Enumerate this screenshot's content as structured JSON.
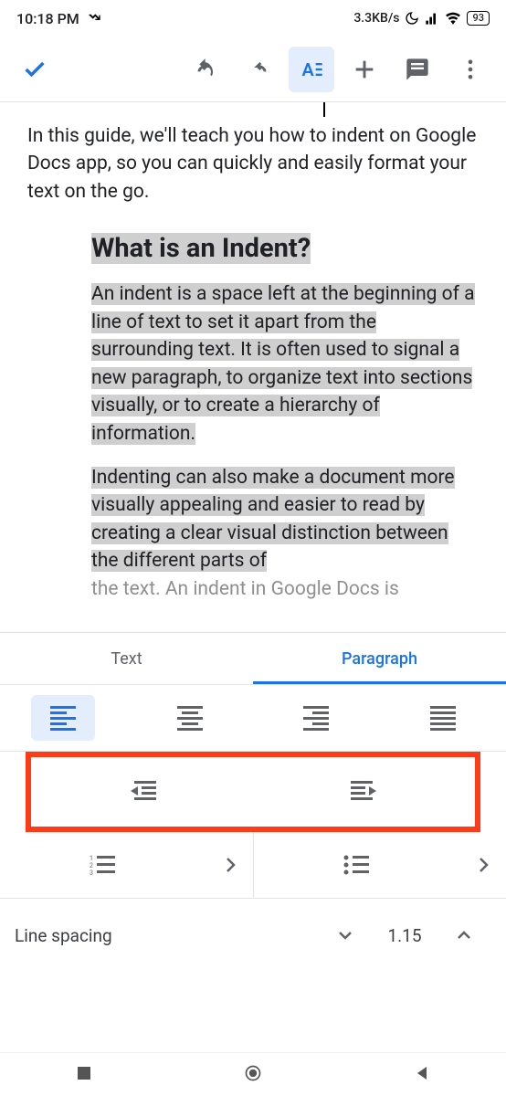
{
  "status": {
    "time": "10:18 PM",
    "net_speed": "3.3KB/s",
    "battery": "93"
  },
  "toolbar": {
    "format_letter": "A"
  },
  "document": {
    "intro": "In this guide, we'll teach you how to indent on Google Docs app, so you can quickly and easily format your text on the go.",
    "heading": "What is an Indent?",
    "p1": "An indent is a space left at the beginning of a line of text to set it apart from the surrounding text. It is often used to signal a new paragraph, to organize text into sections visually, or to create a hierarchy of information.",
    "p2": "Indenting can also make a document more visually appealing and easier to read by creating a clear visual distinction between the different parts of",
    "p2_cut": "the text. An indent in Google Docs is"
  },
  "tabs": {
    "text": "Text",
    "paragraph": "Paragraph"
  },
  "line_spacing": {
    "label": "Line spacing",
    "value": "1.15"
  }
}
